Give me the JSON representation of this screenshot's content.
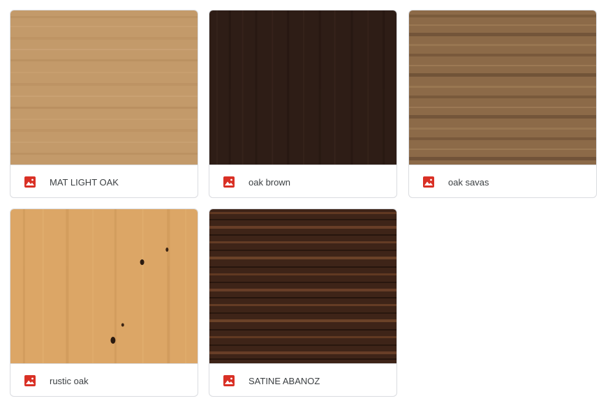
{
  "files": [
    {
      "name": "MAT LIGHT OAK",
      "icon": "image-file-icon",
      "texture": "mat-light-oak",
      "base": "#c39a6a"
    },
    {
      "name": "oak brown",
      "icon": "image-file-icon",
      "texture": "oak-brown",
      "base": "#2e1d16"
    },
    {
      "name": "oak savas",
      "icon": "image-file-icon",
      "texture": "oak-savas",
      "base": "#8c6a48"
    },
    {
      "name": "rustic oak",
      "icon": "image-file-icon",
      "texture": "rustic-oak",
      "base": "#dca666"
    },
    {
      "name": "SATINE ABANOZ",
      "icon": "image-file-icon",
      "texture": "satine-abanoz",
      "base": "#3e2418"
    }
  ],
  "colors": {
    "icon_red": "#d93025",
    "border": "#dadce0",
    "text": "#3c4043"
  }
}
